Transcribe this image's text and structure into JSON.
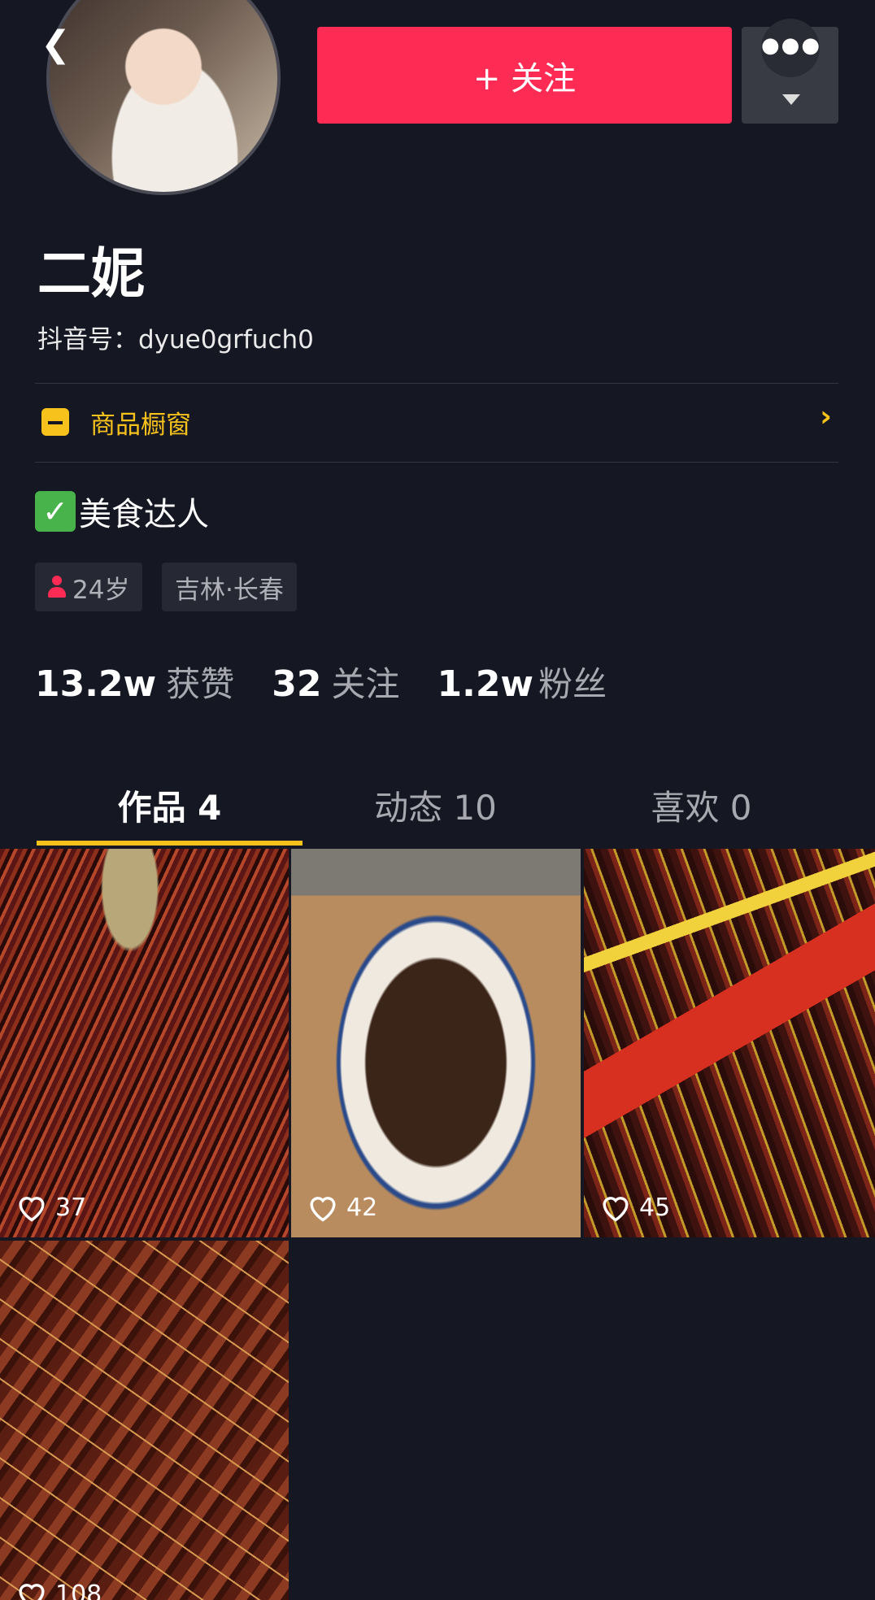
{
  "header": {
    "back_icon": "chevron-left-icon",
    "follow_label": "+ 关注",
    "more_icon": "ellipsis-icon"
  },
  "profile": {
    "name": "二妮",
    "douyin_id": "抖音号：dyue0grfuch0",
    "shop_window_label": "商品橱窗",
    "bio": "美食达人",
    "bio_badge": "✅",
    "tags": [
      "24岁",
      "吉林·长春"
    ]
  },
  "stats": [
    {
      "value": "13.2w",
      "label": "获赞"
    },
    {
      "value": "32",
      "label": "关注"
    },
    {
      "value": "1.2w",
      "label": "粉丝"
    }
  ],
  "tabs": [
    {
      "label": "作品 4",
      "active": true
    },
    {
      "label": "动态 10",
      "active": false
    },
    {
      "label": "喜欢 0",
      "active": false
    }
  ],
  "videos": [
    {
      "likes": "37"
    },
    {
      "likes": "42"
    },
    {
      "likes": "45"
    },
    {
      "likes": "108"
    }
  ],
  "colors": {
    "background": "#151722",
    "follow_button": "#fe2c55",
    "accent_yellow": "#f7c21c"
  }
}
